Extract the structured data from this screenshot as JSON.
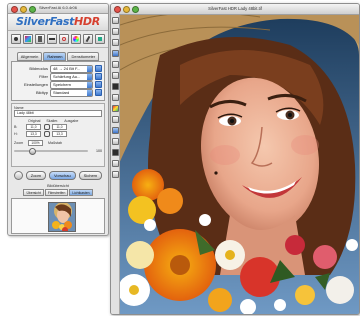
{
  "panel": {
    "window_title": "SilverFast Ai 6.0.4r06",
    "logo_part1": "SilverFast",
    "logo_part2": "HDR",
    "tabs": [
      "Allgemein",
      "Rahmen",
      "Densitometer"
    ],
    "active_tab": 1,
    "settings": [
      {
        "label": "Bildmodus",
        "value": "48 → 24 Bit F..."
      },
      {
        "label": "Filter",
        "value": "Schärfung Au..."
      },
      {
        "label": "Einstellungen",
        "value": "Speichern"
      },
      {
        "label": "Bildtyp",
        "value": "Standard"
      }
    ],
    "frame": {
      "name_label": "Name",
      "name_value": "Lady 48bit",
      "col_original": "Original",
      "col_scale": "Skalier.",
      "col_output": "Ausgabe",
      "row_w_label": "B:",
      "row_h_label": "H:",
      "w_original": "11,0",
      "w_output": "11,0",
      "h_original": "13,3",
      "h_output": "13,3",
      "zoom_label": "Zoom",
      "zoom_value": "100%",
      "scale_label": "Maßstab",
      "scale_value": "100"
    },
    "buttons": {
      "zoom": "Zoom",
      "preview": "Vorschau",
      "save": "Sichern"
    },
    "sub_header": "Bildübersicht",
    "sub_tabs": [
      "Übersicht",
      "Filmstreifen",
      "Lichtkasten"
    ],
    "active_sub_tab": 2
  },
  "preview": {
    "window_title": "SilverFast HDR Lady 48bit.tif"
  },
  "colors": {
    "accent_blue": "#3f79d0",
    "logo_blue": "#2f6fc1",
    "logo_red": "#d6402f"
  }
}
